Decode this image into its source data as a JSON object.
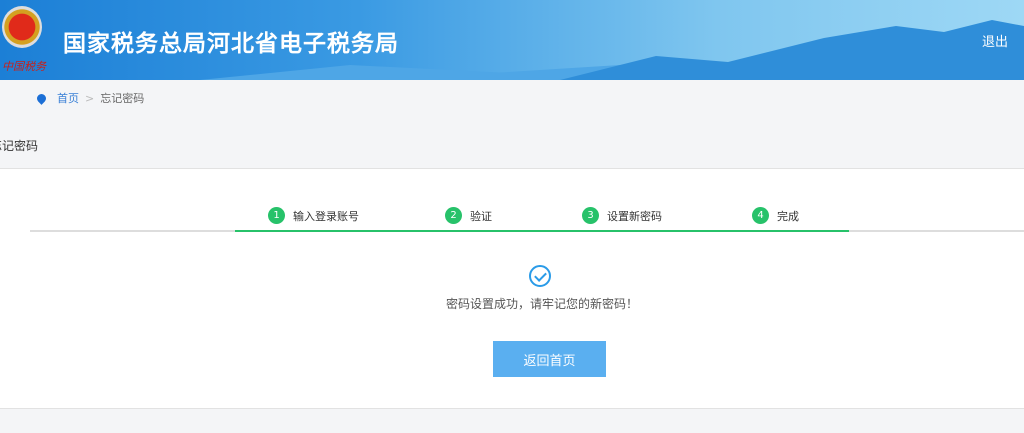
{
  "header": {
    "title": "国家税务总局河北省电子税务局",
    "seal_text": "中国税务",
    "logout": "退出"
  },
  "breadcrumb": {
    "home": "首页",
    "separator": ">",
    "current": "忘记密码"
  },
  "page_title": "忘记密码",
  "steps": [
    {
      "num": "1",
      "label": "输入登录账号"
    },
    {
      "num": "2",
      "label": "验证"
    },
    {
      "num": "3",
      "label": "设置新密码"
    },
    {
      "num": "4",
      "label": "完成"
    }
  ],
  "result": {
    "message": "密码设置成功，请牢记您的新密码！",
    "button": "返回首页"
  }
}
